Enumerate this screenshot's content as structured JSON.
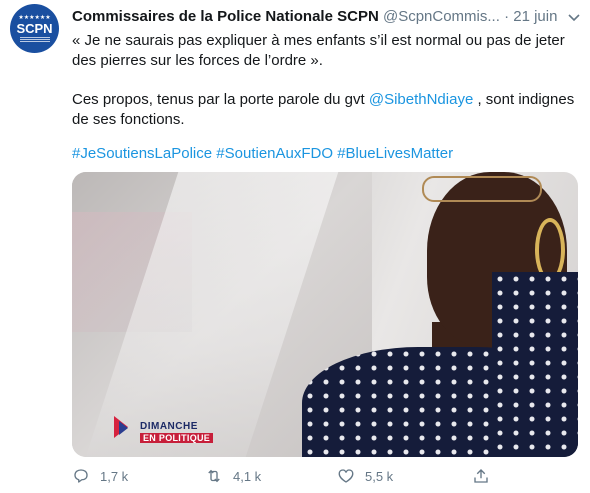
{
  "tweet": {
    "author_name": "Commissaires de la Police Nationale SCPN",
    "handle": "@ScpnCommis...",
    "separator": "·",
    "date": "21 juin",
    "avatar_text": "SCPN",
    "avatar_stars": "★★★★★★",
    "quote": "« Je ne saurais pas expliquer à mes enfants s’il est normal ou pas de jeter des pierres sur les forces de l’ordre ».",
    "body_before_mention": "Ces propos, tenus par la porte parole du gvt ",
    "mention": "@SibethNdiaye",
    "body_after_mention": " , sont indignes de ses fonctions.",
    "hashtags": [
      "#JeSoutiensLaPolice",
      "#SoutienAuxFDO",
      "#BlueLivesMatter"
    ],
    "media": {
      "show_title": "DIMANCHE",
      "show_subtitle": "EN POLITIQUE"
    },
    "actions": {
      "replies": "1,7 k",
      "retweets": "4,1 k",
      "likes": "5,5 k"
    }
  },
  "colors": {
    "link": "#1b95e0",
    "muted": "#657786",
    "text": "#14171a",
    "avatar_bg": "#1a4fa0"
  },
  "icons": [
    "reply-icon",
    "retweet-icon",
    "like-icon",
    "share-icon",
    "chevron-down-icon"
  ]
}
